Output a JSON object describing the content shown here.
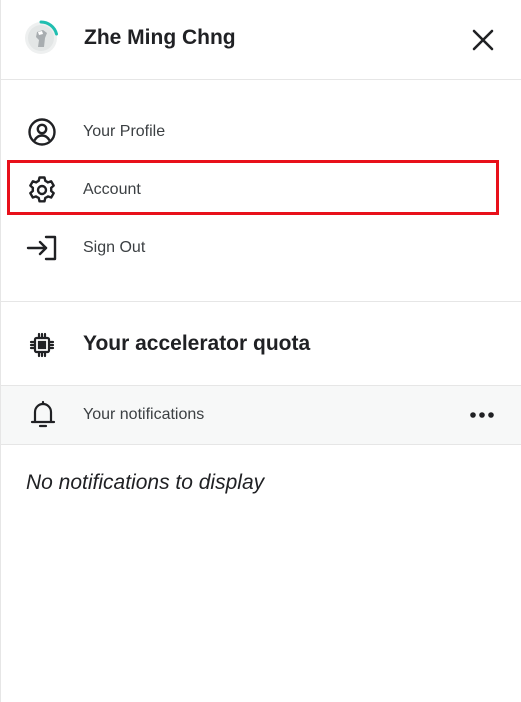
{
  "header": {
    "user_name": "Zhe Ming Chng",
    "close_icon": "close-icon",
    "avatar_progress_color": "#20beb0"
  },
  "menu": {
    "items": [
      {
        "label": "Your Profile",
        "icon": "user-circle-icon"
      },
      {
        "label": "Account",
        "icon": "gear-icon",
        "highlighted": true
      },
      {
        "label": "Sign Out",
        "icon": "sign-out-icon"
      }
    ],
    "highlight_color": "#e8101a"
  },
  "quota": {
    "label": "Your accelerator quota",
    "icon": "chip-icon"
  },
  "notifications": {
    "header_label": "Your notifications",
    "icon": "bell-icon",
    "more_icon": "more-horizontal-icon",
    "empty_text": "No notifications to display"
  }
}
